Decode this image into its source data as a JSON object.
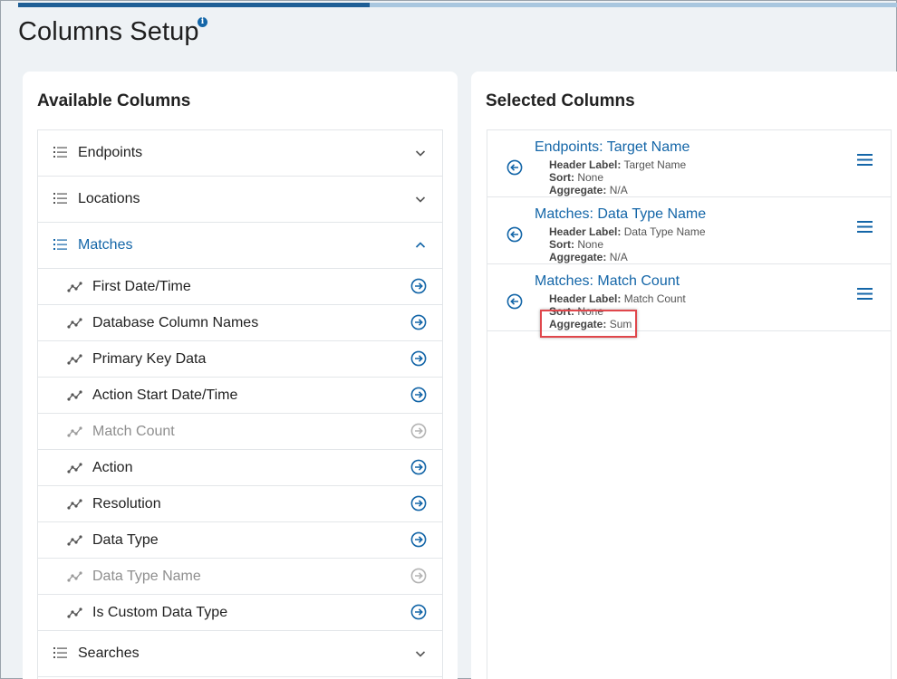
{
  "page": {
    "title": "Columns Setup",
    "info_icon": "info-icon",
    "progress_percent": 40
  },
  "available": {
    "title": "Available Columns",
    "groups": [
      {
        "label": "Endpoints",
        "expanded": false
      },
      {
        "label": "Locations",
        "expanded": false
      },
      {
        "label": "Matches",
        "expanded": true
      },
      {
        "label": "Searches",
        "expanded": false
      }
    ],
    "match_columns": [
      {
        "label": "First Date/Time",
        "enabled": true
      },
      {
        "label": "Database Column Names",
        "enabled": true
      },
      {
        "label": "Primary Key Data",
        "enabled": true
      },
      {
        "label": "Action Start Date/Time",
        "enabled": true
      },
      {
        "label": "Match Count",
        "enabled": false
      },
      {
        "label": "Action",
        "enabled": true
      },
      {
        "label": "Resolution",
        "enabled": true
      },
      {
        "label": "Data Type",
        "enabled": true
      },
      {
        "label": "Data Type Name",
        "enabled": false
      },
      {
        "label": "Is Custom Data Type",
        "enabled": true
      }
    ]
  },
  "selected": {
    "title": "Selected Columns",
    "header_label_key": "Header Label:",
    "sort_key": "Sort:",
    "aggregate_key": "Aggregate:",
    "items": [
      {
        "title": "Endpoints: Target Name",
        "header_label": "Target Name",
        "sort": "None",
        "aggregate": "N/A"
      },
      {
        "title": "Matches: Data Type Name",
        "header_label": "Data Type Name",
        "sort": "None",
        "aggregate": "N/A"
      },
      {
        "title": "Matches: Match Count",
        "header_label": "Match Count",
        "sort": "None",
        "aggregate": "Sum"
      }
    ]
  },
  "colors": {
    "accent": "#1466a8",
    "highlight": "#e0474c",
    "disabled_text": "#8e8e8e"
  }
}
